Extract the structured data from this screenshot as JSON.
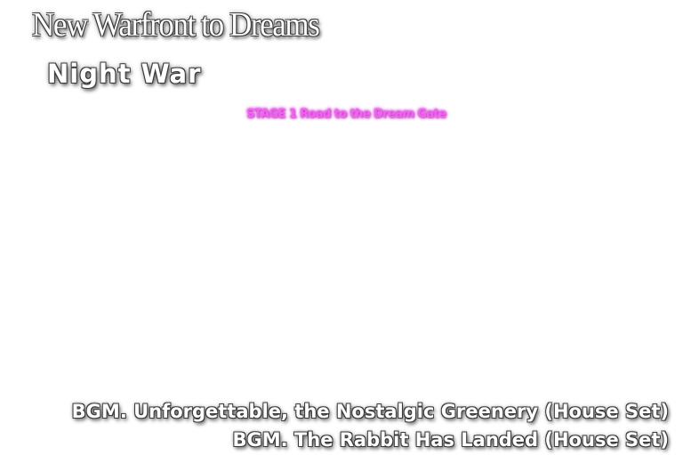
{
  "game": {
    "title": "New Warfront to Dreams",
    "subtitle": "Night War",
    "stage_label": "STAGE 1  Road to the Dream Gate"
  },
  "bgm": [
    "BGM. Unforgettable, the Nostalgic Greenery (House Set)",
    "BGM. The Rabbit Has Landed (House Set)"
  ],
  "colors": {
    "background": "#ffffff",
    "title_text": "#ffffff",
    "title_outline": "#3a3a3a",
    "stage_text": "#ee66ee",
    "stage_glow": "#cc22cc"
  }
}
